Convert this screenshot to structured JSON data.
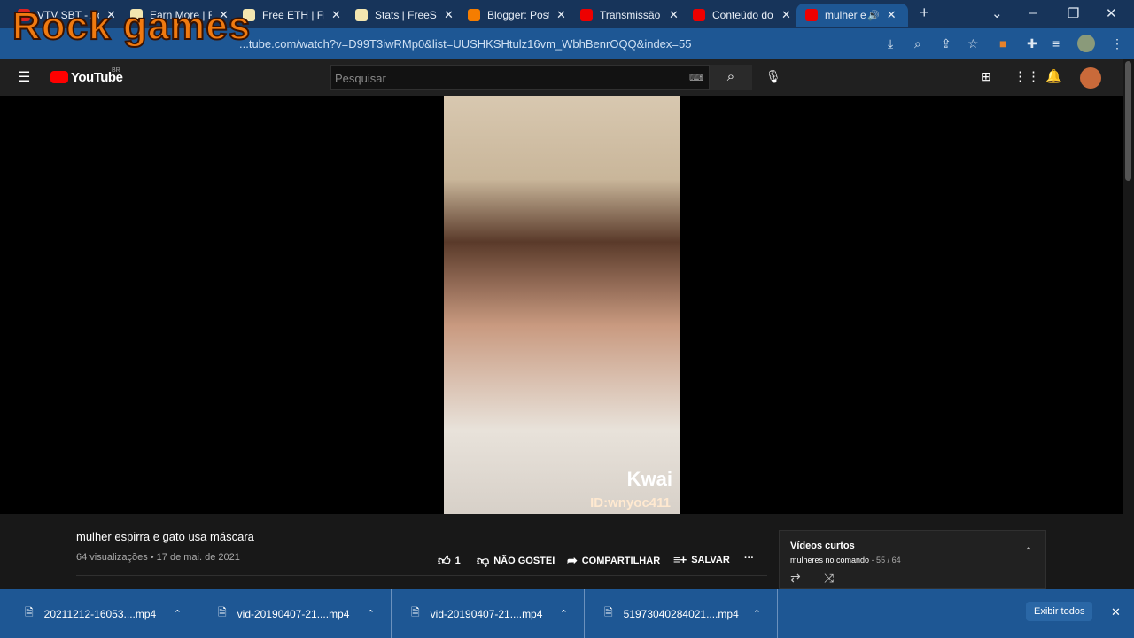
{
  "watermark": "Rock games",
  "tabs": [
    {
      "title": "VTV SBT - Ao",
      "favicon": "#d22"
    },
    {
      "title": "Earn More | F",
      "favicon": "#f3e6b0"
    },
    {
      "title": "Free ETH | Fr",
      "favicon": "#f3e6b0"
    },
    {
      "title": "Stats | FreeSh",
      "favicon": "#f3e6b0"
    },
    {
      "title": "Blogger: Post",
      "favicon": "#f57d00"
    },
    {
      "title": "Transmissão",
      "favicon": "#e00"
    },
    {
      "title": "Conteúdo do",
      "favicon": "#e00"
    },
    {
      "title": "mulher e",
      "favicon": "#e00"
    }
  ],
  "url": "...tube.com/watch?v=D99T3iwRMp0&list=UUSHKSHtulz16vm_WbhBenrOQQ&index=55",
  "youtube": {
    "logo": "YouTube",
    "region": "BR",
    "search_placeholder": "Pesquisar"
  },
  "video": {
    "kwai": "Kwai",
    "kwai_id": "ID:wnyoc411"
  },
  "details": {
    "title": "mulher espirra e gato usa máscara",
    "meta": "64 visualizações • 17 de mai. de 2021",
    "likes": "1",
    "dislike": "NÃO GOSTEI",
    "share": "COMPARTILHAR",
    "save": "SALVAR",
    "more": "···"
  },
  "playlist": {
    "title": "Vídeos curtos",
    "channel": "mulheres no comando",
    "position": " - 55 / 64"
  },
  "downloads": {
    "items": [
      "20211212-16053....mp4",
      "vid-20190407-21....mp4",
      "vid-20190407-21....mp4",
      "51973040284021....mp4"
    ],
    "show_all": "Exibir todos"
  }
}
